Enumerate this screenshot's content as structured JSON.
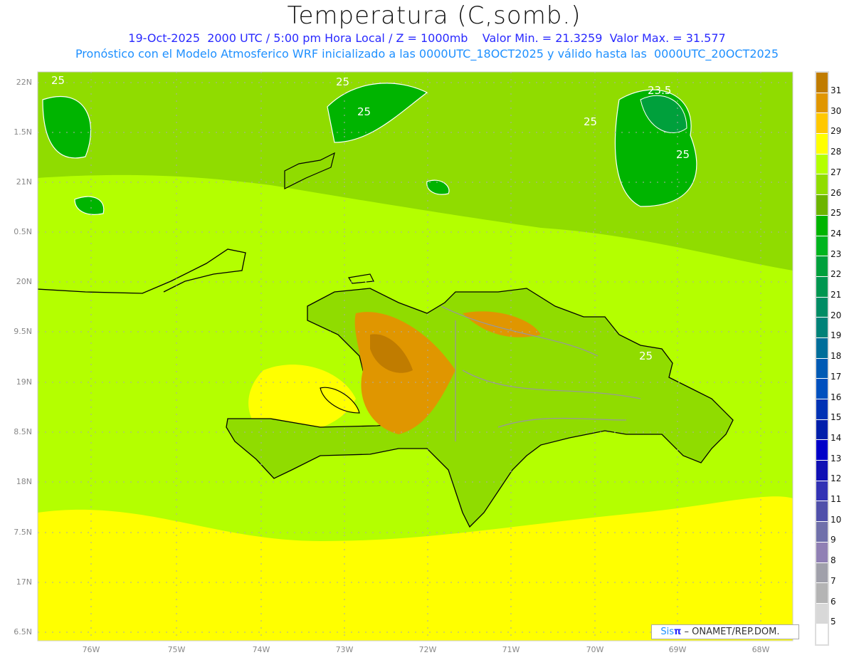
{
  "header": {
    "title": "Temperatura (C,somb.)",
    "line1": "19-Oct-2025  2000 UTC / 5:00 pm Hora Local / Z = 1000mb    Valor Min. = 21.3259  Valor Max. = 31.577",
    "line2": "Pronóstico con el Modelo Atmosferico WRF inicializado a las 0000UTC_18OCT2025 y válido hasta las  0000UTC_20OCT2025"
  },
  "axes": {
    "lat_labels": [
      "22N",
      "1.5N",
      "21N",
      "0.5N",
      "20N",
      "9.5N",
      "19N",
      "8.5N",
      "18N",
      "7.5N",
      "17N",
      "6.5N"
    ],
    "lon_labels": [
      "76W",
      "75W",
      "74W",
      "73W",
      "72W",
      "71W",
      "70W",
      "69W",
      "68W"
    ]
  },
  "contour_labels": [
    "25",
    "25",
    "25",
    "23.5",
    "25",
    "25",
    "25"
  ],
  "colorbar": {
    "labels": [
      "31",
      "30",
      "29",
      "28",
      "27",
      "26",
      "25",
      "24",
      "23",
      "22",
      "21",
      "20",
      "19",
      "18",
      "17",
      "16",
      "15",
      "14",
      "13",
      "12",
      "11",
      "10",
      "9",
      "8",
      "7",
      "6",
      "5"
    ],
    "colors": [
      "#c07c00",
      "#e09600",
      "#ffc800",
      "#ffff00",
      "#b4ff00",
      "#90dc00",
      "#6cb400",
      "#00b400",
      "#00b41e",
      "#00a03c",
      "#009650",
      "#008c64",
      "#008278",
      "#006e9a",
      "#005ab4",
      "#0050be",
      "#0032b4",
      "#001eaa",
      "#0000c8",
      "#1010b4",
      "#3232b4",
      "#5050aa",
      "#7070aa",
      "#9080b4",
      "#a0a0aa",
      "#b4b4b4",
      "#d8d8d8",
      "#ffffff"
    ]
  },
  "logo": {
    "brand": "Sis",
    "pi": "π",
    "rest": " –  ONAMET/REP.DOM."
  }
}
